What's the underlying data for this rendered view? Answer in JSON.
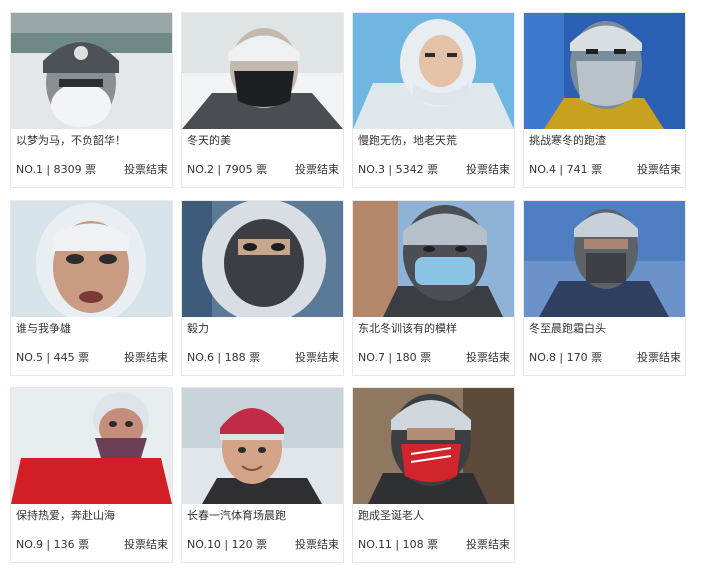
{
  "entries": [
    {
      "title": "以梦为马，不负韶华！",
      "rank": "NO.1",
      "votes": "8309 票",
      "status": "投票结束",
      "photo": "runner-frosted-mask-photo"
    },
    {
      "title": "冬天的美",
      "rank": "NO.2",
      "votes": "7905 票",
      "status": "投票结束",
      "photo": "runner-black-mask-photo"
    },
    {
      "title": "慢跑无伤，地老天荒",
      "rank": "NO.3",
      "votes": "5342 票",
      "status": "投票结束",
      "photo": "runner-snow-hood-photo"
    },
    {
      "title": "挑战寒冬的跑渣",
      "rank": "NO.4",
      "votes": "741 票",
      "status": "投票结束",
      "photo": "runner-frosted-beard-photo"
    },
    {
      "title": "谁与我争雄",
      "rank": "NO.5",
      "votes": "445 票",
      "status": "投票结束",
      "photo": "runner-frosted-eyelashes-photo"
    },
    {
      "title": "毅力",
      "rank": "NO.6",
      "votes": "188 票",
      "status": "投票结束",
      "photo": "runner-frosted-balaclava-photo"
    },
    {
      "title": "东北冬训该有的模样",
      "rank": "NO.7",
      "votes": "180 票",
      "status": "投票结束",
      "photo": "runner-blue-mask-photo"
    },
    {
      "title": "冬至晨跑霜白头",
      "rank": "NO.8",
      "votes": "170 票",
      "status": "投票结束",
      "photo": "runner-frosted-hat-photo"
    },
    {
      "title": "保持热爱，奔赴山海",
      "rank": "NO.9",
      "votes": "136 票",
      "status": "投票结束",
      "photo": "runner-red-jacket-photo"
    },
    {
      "title": "长春一汽体育场晨跑",
      "rank": "NO.10",
      "votes": "120 票",
      "status": "投票结束",
      "photo": "runner-pink-hat-photo"
    },
    {
      "title": "跑成圣诞老人",
      "rank": "NO.11",
      "votes": "108 票",
      "status": "投票结束",
      "photo": "runner-red-mask-photo"
    }
  ],
  "colors": {
    "frost": "#e9eef3",
    "card_border": "#e8e8e8",
    "text": "#333333"
  }
}
